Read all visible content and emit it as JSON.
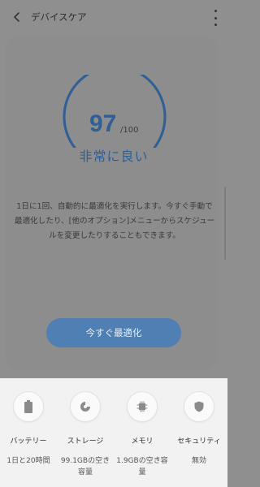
{
  "header": {
    "title": "デバイスケア",
    "back_icon": "back-arrow-icon",
    "more_icon": "more-vert-icon"
  },
  "main": {
    "score": "97",
    "score_max": "/100",
    "score_fraction": 0.97,
    "status": "非常に良い",
    "description": "1日に1回、自動的に最適化を実行します。今すぐ手動で最適化したり、[他のオプション]メニューからスケジュールを変更したりすることもできます。",
    "optimize_label": "今すぐ最適化"
  },
  "bottom": {
    "items": [
      {
        "label": "バッテリー",
        "value": "1日と20時間",
        "icon": "battery-icon"
      },
      {
        "label": "ストレージ",
        "value": "99.1GBの空き容量",
        "icon": "storage-pie-icon"
      },
      {
        "label": "メモリ",
        "value": "1.9GBの空き容量",
        "icon": "memory-chip-icon"
      },
      {
        "label": "セキュリティ",
        "value": "無効",
        "icon": "shield-icon"
      }
    ]
  },
  "colors": {
    "accent": "#2f5f95",
    "button": "#4f7fb3",
    "overlay": "#8f8f8f",
    "bottom_bg": "#f2f2f2"
  }
}
